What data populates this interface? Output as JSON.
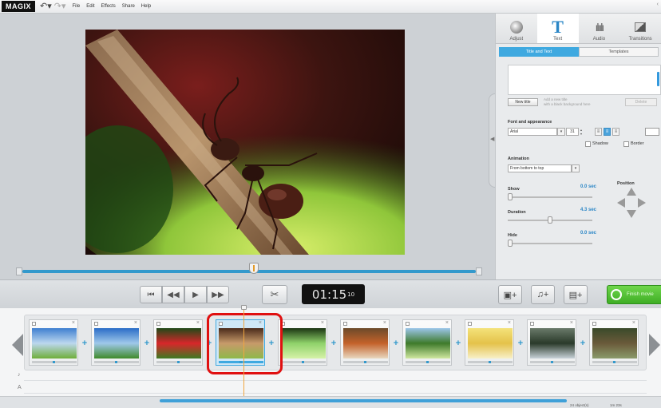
{
  "menubar": {
    "logo": "MAGIX",
    "undo_icon": "undo-arrow-icon",
    "redo_icon": "redo-arrow-icon",
    "items": [
      "File",
      "Edit",
      "Effects",
      "Share",
      "Help"
    ]
  },
  "panel": {
    "tabs": [
      {
        "label": "Adjust",
        "icon": "adjust-knob-icon"
      },
      {
        "label": "Text",
        "icon": "text-t-icon"
      },
      {
        "label": "Audio",
        "icon": "audio-waveform-icon"
      },
      {
        "label": "Transitions",
        "icon": "transitions-icon"
      }
    ],
    "active_tab": "Text",
    "subtabs": [
      "Title and Text",
      "Templates"
    ],
    "active_subtab": "Title and Text",
    "new_title_label": "New title",
    "new_title_hint": "Add a new title\nwith a black background here",
    "delete_label": "Delete",
    "font_section": "Font and appearance",
    "font_name": "Arial",
    "font_size": "31",
    "shadow_label": "Shadow",
    "border_label": "Border",
    "animation_section": "Animation",
    "animation_value": "From bottom to top",
    "show_label": "Show",
    "show_value": "0.0 sec",
    "show_fraction": 0.0,
    "duration_label": "Duration",
    "duration_value": "4.3 sec",
    "duration_fraction": 0.5,
    "hide_label": "Hide",
    "hide_value": "0.0 sec",
    "hide_fraction": 0.0,
    "position_label": "Position"
  },
  "transport": {
    "timecode": "01:15",
    "timecode_frames": "10",
    "finish_label": "Finish movie"
  },
  "storyboard": {
    "clips": [
      {
        "name": "Meadow landscape",
        "colors": [
          "#3f7fd0",
          "#bcd7ef",
          "#6fae3a"
        ]
      },
      {
        "name": "Grass and sky",
        "colors": [
          "#2a6cc7",
          "#9fc8ea",
          "#3f8a2a"
        ]
      },
      {
        "name": "Red flower",
        "colors": [
          "#1f4a18",
          "#d8262a",
          "#3e7a22"
        ]
      },
      {
        "name": "Ant on stem",
        "colors": [
          "#4a2a1a",
          "#c79a6a",
          "#8fb84a"
        ]
      },
      {
        "name": "Green leaves",
        "colors": [
          "#1b3512",
          "#8fd26a",
          "#d6f2a8"
        ]
      },
      {
        "name": "Squirrel",
        "colors": [
          "#6b4a2a",
          "#c4622a",
          "#e8d8c0"
        ]
      },
      {
        "name": "Lone tree",
        "colors": [
          "#9cc6ea",
          "#3e7a2a",
          "#cfe7a0"
        ]
      },
      {
        "name": "Woman in field",
        "colors": [
          "#f4e27a",
          "#e4c24a",
          "#f7f0c8"
        ]
      },
      {
        "name": "Rocky stream",
        "colors": [
          "#6a7a6a",
          "#2a3a2a",
          "#c8d2d8"
        ]
      },
      {
        "name": "Animal in forest",
        "colors": [
          "#3a4a2a",
          "#6a5a3a",
          "#8a9a6a"
        ]
      }
    ],
    "selected_index": 3,
    "status_objects": "24 object(s)",
    "status_length": "1m 23s"
  }
}
